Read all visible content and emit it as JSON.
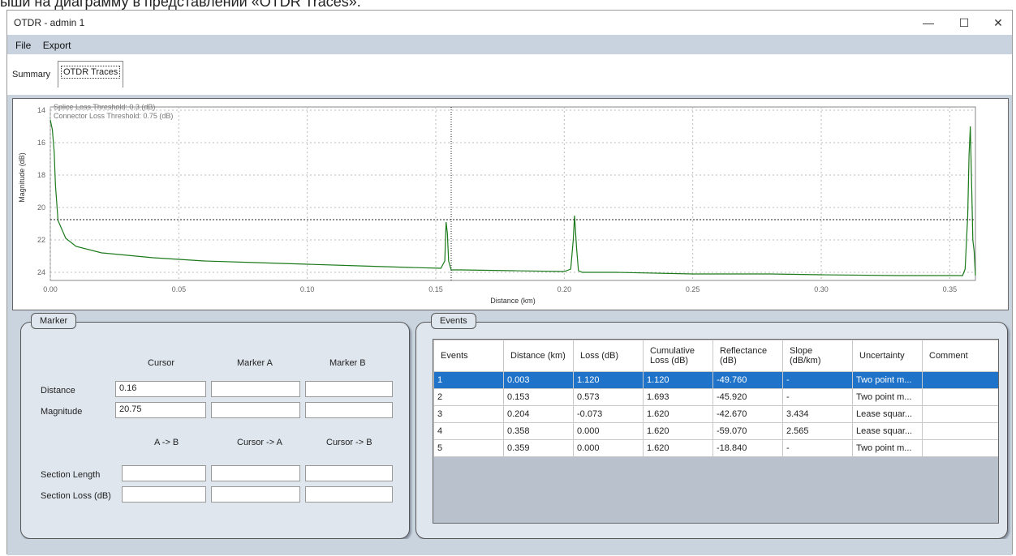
{
  "caption": "ыши на диаграмму в представлении «OTDR Traces».",
  "window": {
    "title": "OTDR - admin 1",
    "minimize": "—",
    "maximize": "☐",
    "close": "✕"
  },
  "menu": {
    "file": "File",
    "export": "Export"
  },
  "tabs": [
    {
      "label": "Summary"
    },
    {
      "label": "OTDR Traces"
    }
  ],
  "chart_data": {
    "type": "line",
    "xlabel": "Distance (km)",
    "ylabel": "Magnitude (dB)",
    "xlim": [
      0.0,
      0.36
    ],
    "ylim": [
      24.5,
      13.8
    ],
    "y_inverted": true,
    "xticks": [
      "0.00",
      "0.05",
      "0.10",
      "0.15",
      "0.20",
      "0.25",
      "0.30",
      "0.35"
    ],
    "yticks": [
      "14",
      "16",
      "18",
      "20",
      "22",
      "24"
    ],
    "annotations": [
      "Splice Loss Threshold: 0.3 (dB)",
      "Connector Loss Threshold: 0.75 (dB)"
    ],
    "cursor_x": 0.156,
    "cursor_y": 20.75,
    "grid": true,
    "series": [
      {
        "color": "#1a7a1a",
        "x": [
          0.0,
          0.0008,
          0.0015,
          0.002,
          0.003,
          0.006,
          0.01,
          0.02,
          0.04,
          0.06,
          0.08,
          0.1,
          0.12,
          0.14,
          0.152,
          0.1535,
          0.154,
          0.1545,
          0.155,
          0.156,
          0.16,
          0.18,
          0.2,
          0.2025,
          0.2035,
          0.204,
          0.2048,
          0.2055,
          0.207,
          0.22,
          0.25,
          0.28,
          0.3,
          0.33,
          0.35,
          0.355,
          0.356,
          0.357,
          0.3575,
          0.358,
          0.3585,
          0.359,
          0.3595,
          0.36
        ],
        "y": [
          14.6,
          15.2,
          16.6,
          18.6,
          20.8,
          21.9,
          22.4,
          22.8,
          23.1,
          23.3,
          23.4,
          23.5,
          23.6,
          23.7,
          23.75,
          23.3,
          20.9,
          21.6,
          23.3,
          23.85,
          23.85,
          23.9,
          23.95,
          23.8,
          22.0,
          20.5,
          22.5,
          23.9,
          24.0,
          24.0,
          24.1,
          24.1,
          24.15,
          24.2,
          24.2,
          24.2,
          23.8,
          20.5,
          16.8,
          15.0,
          18.5,
          22.0,
          22.7,
          24.2
        ]
      }
    ]
  },
  "marker": {
    "title": "Marker",
    "col_cursor": "Cursor",
    "col_a": "Marker A",
    "col_b": "Marker B",
    "distance_label": "Distance",
    "magnitude_label": "Magnitude",
    "distance_cursor": "0.16",
    "magnitude_cursor": "20.75",
    "col_ab": "A -> B",
    "col_cursor_a": "Cursor -> A",
    "col_cursor_b": "Cursor -> B",
    "section_length_label": "Section Length",
    "section_loss_label": "Section Loss (dB)"
  },
  "events": {
    "title": "Events",
    "headers": [
      "Events",
      "Distance (km)",
      "Loss (dB)",
      "Cumulative Loss (dB)",
      "Reflectance (dB)",
      "Slope (dB/km)",
      "Uncertainty",
      "Comment"
    ],
    "rows": [
      [
        "1",
        "0.003",
        "1.120",
        "1.120",
        "-49.760",
        "-",
        "Two point m...",
        ""
      ],
      [
        "2",
        "0.153",
        "0.573",
        "1.693",
        "-45.920",
        "-",
        "Two point m...",
        ""
      ],
      [
        "3",
        "0.204",
        "-0.073",
        "1.620",
        "-42.670",
        "3.434",
        "Lease squar...",
        ""
      ],
      [
        "4",
        "0.358",
        "0.000",
        "1.620",
        "-59.070",
        "2.565",
        "Lease squar...",
        ""
      ],
      [
        "5",
        "0.359",
        "0.000",
        "1.620",
        "-18.840",
        "-",
        "Two point m...",
        ""
      ]
    ],
    "selected_row": 0
  }
}
